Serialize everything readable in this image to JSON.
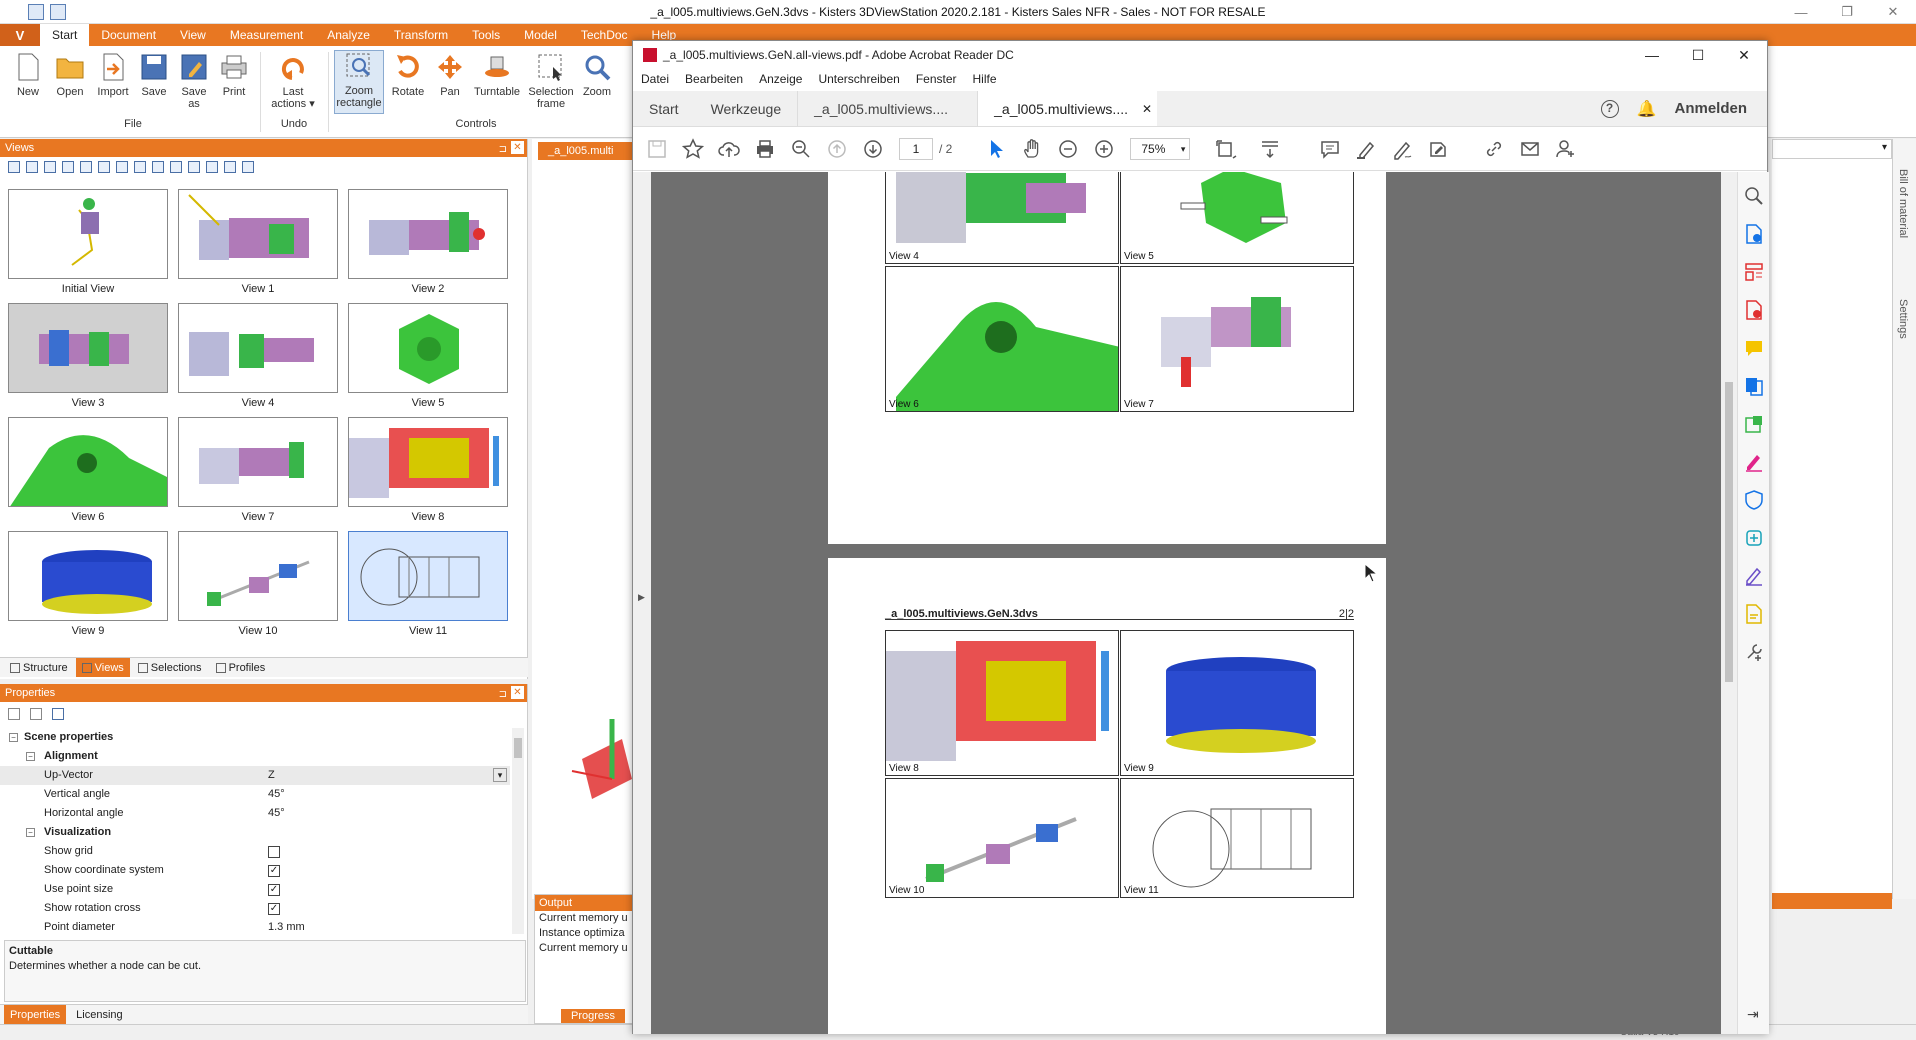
{
  "background_app": {
    "title": "_a_l005.multiviews.GeN.3dvs - Kisters 3DViewStation 2020.2.181 - Kisters Sales NFR - Sales - NOT FOR RESALE",
    "app_menu_label": "V",
    "ribbon_tabs": [
      "Start",
      "Document",
      "View",
      "Measurement",
      "Analyze",
      "Transform",
      "Tools",
      "Model",
      "TechDoc",
      "Help"
    ],
    "active_tab": "Start",
    "file_group": {
      "label": "File",
      "buttons": [
        "New",
        "Open",
        "Import",
        "Save",
        "Save as",
        "Print"
      ]
    },
    "undo_group": {
      "label": "Undo",
      "buttons": [
        "Last actions"
      ]
    },
    "controls_group": {
      "label": "Controls",
      "buttons": [
        "Zoom rectangle",
        "Rotate",
        "Pan",
        "Turntable",
        "Selection frame",
        "Zoom"
      ]
    },
    "views_panel": {
      "title": "Views",
      "thumbnails": [
        "Initial View",
        "View 1",
        "View 2",
        "View 3",
        "View 4",
        "View 5",
        "View 6",
        "View 7",
        "View 8",
        "View 9",
        "View 10",
        "View 11"
      ],
      "selected": "View 11",
      "bottom_tabs": [
        "Structure",
        "Views",
        "Selections",
        "Profiles"
      ],
      "active_bottom_tab": "Views"
    },
    "properties_panel": {
      "title": "Properties",
      "scene_properties": "Scene properties",
      "alignment": "Alignment",
      "up_vector_label": "Up-Vector",
      "up_vector_value": "Z",
      "vertical_angle_label": "Vertical angle",
      "vertical_angle_value": "45°",
      "horizontal_angle_label": "Horizontal angle",
      "horizontal_angle_value": "45°",
      "visualization": "Visualization",
      "show_grid_label": "Show grid",
      "show_coordinate_system_label": "Show coordinate system",
      "use_point_size_label": "Use point size",
      "show_rotation_cross_label": "Show rotation cross",
      "point_diameter_label": "Point diameter",
      "point_diameter_value": "1.3 mm",
      "show_grid": false,
      "show_coordinate_system": true,
      "use_point_size": true,
      "show_rotation_cross": true,
      "help_title": "Cuttable",
      "help_text": "Determines whether a node can be cut.",
      "bottom_tabs": [
        "Properties",
        "Licensing"
      ],
      "active_bottom_tab": "Properties"
    },
    "document_tab": "_a_l005.multi",
    "output_panel": {
      "title": "Output",
      "lines": [
        "Current memory u",
        "Instance optimiza",
        "Current memory u"
      ],
      "progress_tab": "Progress"
    },
    "right_panel_tabs": [
      "Bill of material",
      "Settings"
    ],
    "statusbar_fragments": [
      "Catia V5 R10"
    ],
    "accent_color": "#e87722"
  },
  "acrobat": {
    "title": "_a_l005.multiviews.GeN.all-views.pdf - Adobe Acrobat Reader DC",
    "menu": [
      "Datei",
      "Bearbeiten",
      "Anzeige",
      "Unterschreiben",
      "Fenster",
      "Hilfe"
    ],
    "tabs": [
      "Start",
      "Werkzeuge"
    ],
    "doc_tabs": [
      "_a_l005.multiviews....",
      "_a_l005.multiviews...."
    ],
    "active_doc_tab_index": 1,
    "help_glyph": "?",
    "login": "Anmelden",
    "page_current": "1",
    "page_total": "/ 2",
    "zoom": "75%",
    "page2_header_title": "_a_l005.multiviews.GeN.3dvs",
    "page2_header_page": "2|2",
    "page1_views": [
      "View 4",
      "View 5",
      "View 6",
      "View 7"
    ],
    "page2_views": [
      "View 8",
      "View 9",
      "View 10",
      "View 11"
    ]
  }
}
